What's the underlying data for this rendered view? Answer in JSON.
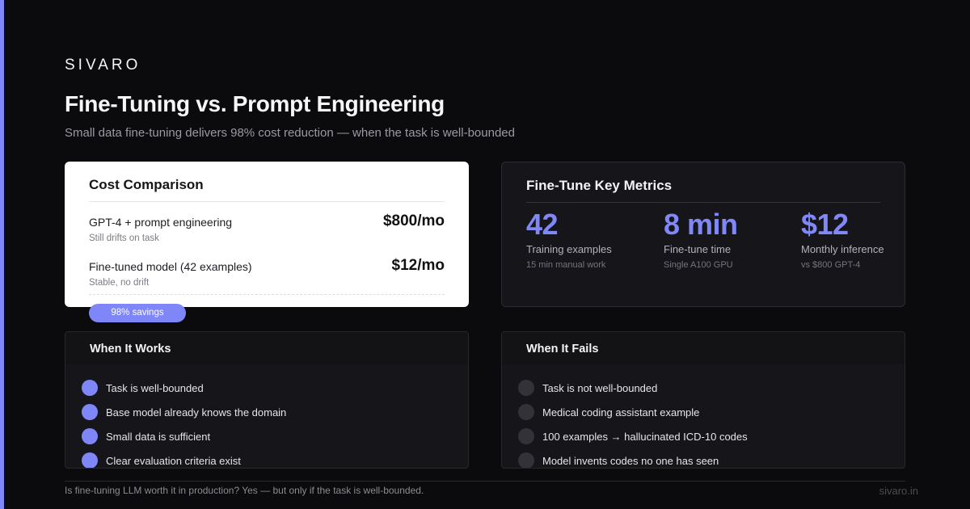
{
  "brand": "SIVARO",
  "title": "Fine-Tuning vs. Prompt Engineering",
  "subtitle": "Small data fine-tuning delivers 98% cost reduction — when the task is well-bounded",
  "cost_card": {
    "heading": "Cost Comparison",
    "rows": [
      {
        "label": "GPT-4 + prompt engineering",
        "note": "Still drifts on task",
        "price": "$800/mo"
      },
      {
        "label": "Fine-tuned model (42 examples)",
        "note": "Stable, no drift",
        "price": "$12/mo"
      }
    ],
    "savings": "98% savings"
  },
  "metrics_card": {
    "heading": "Fine-Tune Key Metrics",
    "metrics": [
      {
        "value": "42",
        "label": "Training examples",
        "sub": "15 min manual work"
      },
      {
        "value": "8 min",
        "label": "Fine-tune time",
        "sub": "Single A100 GPU"
      },
      {
        "value": "$12",
        "label": "Monthly inference",
        "sub": "vs $800 GPT-4"
      }
    ]
  },
  "works": {
    "heading": "When It Works",
    "items": [
      "Task is well-bounded",
      "Base model already knows the domain",
      "Small data is sufficient",
      "Clear evaluation criteria exist"
    ]
  },
  "fails": {
    "heading": "When It Fails",
    "items": [
      "Task is not well-bounded",
      "Medical coding assistant example",
      "100 examples → hallucinated ICD-10 codes",
      "Model invents codes no one has seen"
    ]
  },
  "footer": {
    "text": "Is fine-tuning LLM worth it in production? Yes — but only if the task is well-bounded.",
    "domain": "sivaro.in"
  },
  "colors": {
    "accent": "#7f86f7",
    "background": "#0b0b0d",
    "card_dark": "#16161a",
    "card_light": "#ffffff"
  }
}
